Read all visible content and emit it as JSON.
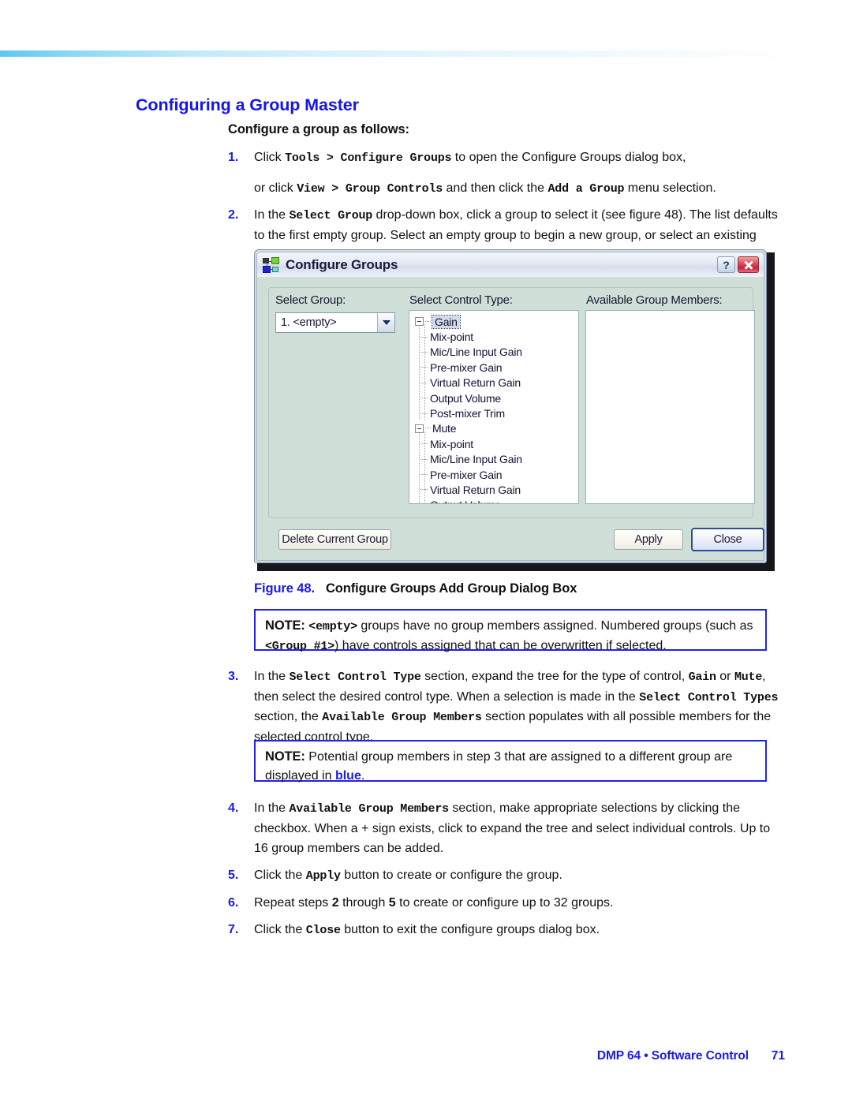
{
  "header": {
    "rule": "gradient-rule"
  },
  "section": {
    "title": "Configuring a Group Master",
    "subhead": "Configure a group as follows:"
  },
  "steps_part1": [
    {
      "num": "1.",
      "lines": [
        [
          {
            "t": "Click ",
            "s": "plain"
          },
          {
            "t": "Tools > Configure Groups",
            "s": "mono"
          },
          {
            "t": " to open the Configure Groups dialog box,",
            "s": "plain"
          }
        ],
        [
          {
            "t": "or click ",
            "s": "plain"
          },
          {
            "t": "View > Group Controls",
            "s": "mono"
          },
          {
            "t": " and then click the ",
            "s": "plain"
          },
          {
            "t": "Add a Group",
            "s": "mono"
          },
          {
            "t": " menu selection.",
            "s": "plain"
          }
        ]
      ]
    },
    {
      "num": "2.",
      "lines": [
        [
          {
            "t": "In the ",
            "s": "plain"
          },
          {
            "t": "Select Group",
            "s": "mono"
          },
          {
            "t": " drop-down box, click a group to select it (see figure 48). The list defaults to the first empty group. Select an empty group to begin a new group, or select an existing group to modify.",
            "s": "plain"
          }
        ]
      ]
    }
  ],
  "dialog": {
    "title": "Configure Groups",
    "title_icon": "group-network-icon",
    "help_button": "?",
    "close_button": "close-x-icon",
    "labels": {
      "select_group": "Select Group:",
      "select_control_type": "Select Control Type:",
      "available_group_members": "Available Group Members:"
    },
    "select_group_value": "1. <empty>",
    "select_group_options": [
      "1. <empty>"
    ],
    "tree": [
      {
        "label": "Gain",
        "selected": true,
        "expanded": true,
        "children": [
          "Mix-point",
          "Mic/Line Input Gain",
          "Pre-mixer Gain",
          "Virtual Return Gain",
          "Output Volume",
          "Post-mixer Trim"
        ]
      },
      {
        "label": "Mute",
        "selected": false,
        "expanded": true,
        "children": [
          "Mix-point",
          "Mic/Line Input Gain",
          "Pre-mixer Gain",
          "Virtual Return Gain",
          "Output Volume"
        ]
      }
    ],
    "members": [],
    "buttons": {
      "delete": "Delete Current Group",
      "apply": "Apply",
      "close": "Close"
    },
    "colors": {
      "dialog_bg": "#cfdfd8",
      "close_btn_red": "#cc1f3d",
      "default_btn_border": "#2d4c9e"
    }
  },
  "figure": {
    "number": "Figure 48.",
    "caption": "Configure Groups Add Group Dialog Box"
  },
  "note_1": {
    "keyword": "NOTE:",
    "runs": [
      {
        "t": "<empty>",
        "s": "mono"
      },
      {
        "t": " groups have no group members assigned. Numbered groups (such as ",
        "s": "plain"
      },
      {
        "t": "<Group #1>",
        "s": "mono"
      },
      {
        "t": ") have controls assigned that can be overwritten if selected.",
        "s": "plain"
      }
    ]
  },
  "note_2": {
    "keyword": "NOTE:",
    "runs": [
      {
        "t": "Potential group members in step 3 that are assigned to a different group are displayed in ",
        "s": "plain"
      },
      {
        "t": "blue",
        "s": "blue"
      },
      {
        "t": ".",
        "s": "plain"
      }
    ]
  },
  "steps_part2": [
    {
      "num": "3.",
      "lines": [
        [
          {
            "t": "In the ",
            "s": "plain"
          },
          {
            "t": "Select Control Type",
            "s": "mono"
          },
          {
            "t": " section, expand the tree for the type of control, ",
            "s": "plain"
          },
          {
            "t": "Gain",
            "s": "mono"
          },
          {
            "t": " or ",
            "s": "plain"
          },
          {
            "t": "Mute",
            "s": "mono"
          },
          {
            "t": ", then select the desired control type. When a selection is made in the ",
            "s": "plain"
          },
          {
            "t": "Select Control Types",
            "s": "mono"
          },
          {
            "t": " section, the ",
            "s": "plain"
          },
          {
            "t": "Available Group Members",
            "s": "mono"
          },
          {
            "t": " section populates with all possible members for the selected control type.",
            "s": "plain"
          }
        ]
      ]
    }
  ],
  "steps_part3": [
    {
      "num": "4.",
      "lines": [
        [
          {
            "t": "In the ",
            "s": "plain"
          },
          {
            "t": "Available Group Members",
            "s": "mono"
          },
          {
            "t": " section, make appropriate selections by clicking the checkbox. When a + sign exists, click to expand the tree and select individual controls. Up to 16 group members can be added.",
            "s": "plain"
          }
        ]
      ]
    },
    {
      "num": "5.",
      "lines": [
        [
          {
            "t": "Click the ",
            "s": "plain"
          },
          {
            "t": "Apply",
            "s": "mono"
          },
          {
            "t": " button to create or configure the group.",
            "s": "plain"
          }
        ]
      ]
    },
    {
      "num": "6.",
      "lines": [
        [
          {
            "t": "Repeat steps ",
            "s": "plain"
          },
          {
            "t": "2",
            "s": "bold"
          },
          {
            "t": " through ",
            "s": "plain"
          },
          {
            "t": "5",
            "s": "bold"
          },
          {
            "t": " to create or configure up to 32 groups.",
            "s": "plain"
          }
        ]
      ]
    },
    {
      "num": "7.",
      "lines": [
        [
          {
            "t": "Click the ",
            "s": "plain"
          },
          {
            "t": "Close",
            "s": "mono"
          },
          {
            "t": " button to exit the configure groups dialog box.",
            "s": "plain"
          }
        ]
      ]
    }
  ],
  "footer": {
    "text": "DMP 64 • Software Control",
    "page": "71"
  }
}
